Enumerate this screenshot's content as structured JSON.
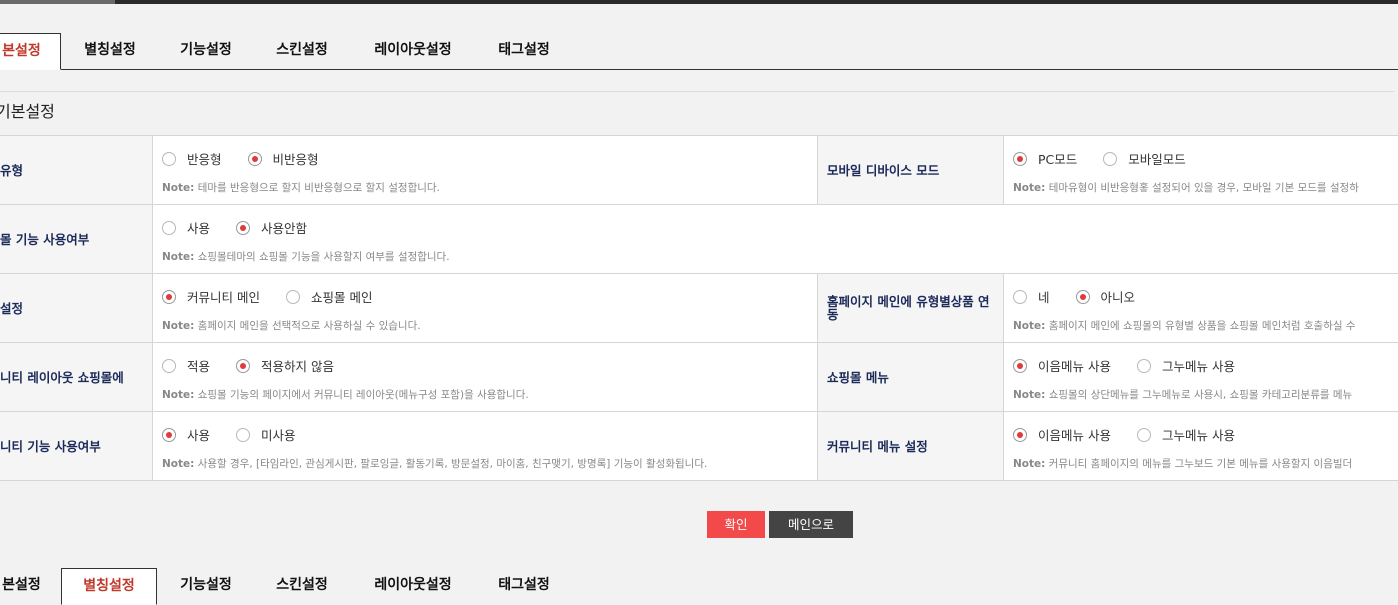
{
  "tabs": [
    "본설정",
    "별칭설정",
    "기능설정",
    "스킨설정",
    "레이아웃설정",
    "태그설정"
  ],
  "section_title": "기본설정",
  "note_prefix": "Note:",
  "rows": [
    {
      "left": {
        "label": "유형",
        "options": [
          "반응형",
          "비반응형"
        ],
        "selected": 1,
        "note": "테마를 반응형으로 할지 비반응형으로 할지 설정합니다."
      },
      "right": {
        "label": "모바일 디바이스 모드",
        "options": [
          "PC모드",
          "모바일모드"
        ],
        "selected": 0,
        "note": "테마유형이 비반응형홓 설정되어 있을 경우, 모바일 기본 모드를 설정하"
      }
    },
    {
      "left": {
        "label": "몰 기능 사용여부",
        "options": [
          "사용",
          "사용안함"
        ],
        "selected": 1,
        "note": "쇼핑몰테마의 쇼핑몰 기능을 사용할지 여부를 설정합니다."
      }
    },
    {
      "left": {
        "label": "설정",
        "options": [
          "커뮤니티 메인",
          "쇼핑몰 메인"
        ],
        "selected": 0,
        "note": "홈페이지 메인을 선택적으로 사용하실 수 있습니다."
      },
      "right": {
        "label": "홈페이지 메인에 유형별상품 연동",
        "options": [
          "네",
          "아니오"
        ],
        "selected": 1,
        "note": "홈페이지 메인에 쇼핑몰의 유형별 상품을 쇼핑몰 메인처럼 호출하실 수"
      }
    },
    {
      "left": {
        "label": "니티 레이아웃 쇼핑몰에",
        "options": [
          "적용",
          "적용하지 않음"
        ],
        "selected": 1,
        "note": "쇼핑몰 기능의 페이지에서 커뮤니티 레이아웃(메뉴구성 포함)을 사용합니다."
      },
      "right": {
        "label": "쇼핑몰 메뉴",
        "options": [
          "이음메뉴 사용",
          "그누메뉴 사용"
        ],
        "selected": 0,
        "note": "쇼핑몰의 상단메뉴를 그누메뉴로 사용시, 쇼핑몰 카테고리분류를 메뉴"
      }
    },
    {
      "left": {
        "label": "니티 기능 사용여부",
        "options": [
          "사용",
          "미사용"
        ],
        "selected": 0,
        "note": "사용할 경우, [타임라인, 관심게시판, 팔로잉글, 활동기록, 방문설정, 마이홈, 친구맺기, 방명록] 기능이 활성화됩니다."
      },
      "right": {
        "label": "커뮤니티 메뉴 설정",
        "options": [
          "이음메뉴 사용",
          "그누메뉴 사용"
        ],
        "selected": 0,
        "note": "커뮤니티 홈페이지의 메뉴를 그누보드 기본 메뉴를 사용할지 이음빌더"
      }
    }
  ],
  "buttons": {
    "confirm": "확인",
    "main": "메인으로"
  },
  "colors": {
    "accent": "#c0392b",
    "radio_on": "#e03a3a",
    "confirm_bg": "#f24a4a",
    "main_bg": "#444444",
    "label": "#1b2a59"
  }
}
